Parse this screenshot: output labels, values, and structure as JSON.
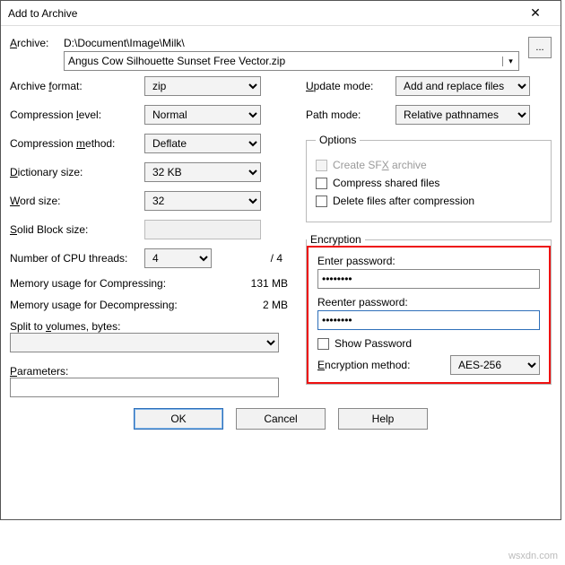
{
  "window": {
    "title": "Add to Archive"
  },
  "archive": {
    "label": "Archive:",
    "path": "D:\\Document\\Image\\Milk\\",
    "filename": "Angus Cow Silhouette Sunset Free Vector.zip",
    "browse": "..."
  },
  "left": {
    "archive_format_label": "Archive format:",
    "archive_format_value": "zip",
    "compression_level_label": "Compression level:",
    "compression_level_value": "Normal",
    "compression_method_label": "Compression method:",
    "compression_method_value": "Deflate",
    "dictionary_label": "Dictionary size:",
    "dictionary_value": "32 KB",
    "word_label": "Word size:",
    "word_value": "32",
    "solid_label": "Solid Block size:",
    "cpu_label": "Number of CPU threads:",
    "cpu_value": "4",
    "cpu_total": "/ 4",
    "mem_compress_label": "Memory usage for Compressing:",
    "mem_compress_value": "131 MB",
    "mem_decompress_label": "Memory usage for Decompressing:",
    "mem_decompress_value": "2 MB",
    "split_label": "Split to volumes, bytes:",
    "params_label": "Parameters:"
  },
  "right": {
    "update_label": "Update mode:",
    "update_value": "Add and replace files",
    "path_label": "Path mode:",
    "path_value": "Relative pathnames",
    "options_legend": "Options",
    "opt_sfx": "Create SFX archive",
    "opt_shared": "Compress shared files",
    "opt_delete": "Delete files after compression",
    "enc_legend": "Encryption",
    "enter_pw": "Enter password:",
    "reenter_pw": "Reenter password:",
    "pw_value": "••••••••",
    "show_pw": "Show Password",
    "enc_method_label": "Encryption method:",
    "enc_method_value": "AES-256"
  },
  "buttons": {
    "ok": "OK",
    "cancel": "Cancel",
    "help": "Help"
  },
  "watermark": "wsxdn.com"
}
